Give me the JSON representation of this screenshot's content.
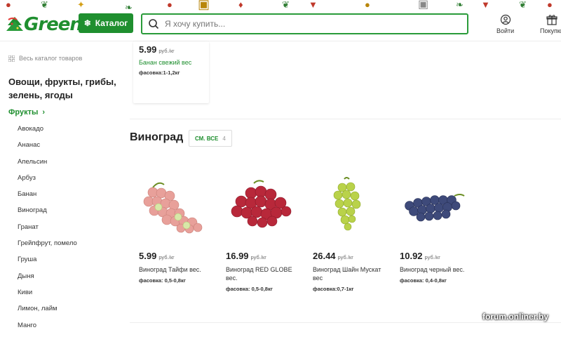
{
  "header": {
    "logo_text": "Green",
    "catalog_button": "Каталог",
    "search_placeholder": "Я хочу купить...",
    "login_label": "Войти",
    "cart_label": "Покупки",
    "brand_color": "#1f8f2f"
  },
  "sidebar": {
    "all_catalog": "Весь каталог товаров",
    "category_title": "Овощи, фрукты, грибы, зелень, ягоды",
    "active_category": "Фрукты",
    "items": [
      "Авокадо",
      "Ананас",
      "Апельсин",
      "Арбуз",
      "Банан",
      "Виноград",
      "Гранат",
      "Грейпфрут, помело",
      "Груша",
      "Дыня",
      "Киви",
      "Лимон, лайм",
      "Манго"
    ]
  },
  "top_card": {
    "price": "5.99",
    "unit": "руб./кг",
    "name": "Банан свежий вес",
    "pack": "фасовка:1-1,2кг"
  },
  "section": {
    "title": "Виноград",
    "see_all_label": "СМ. ВСЕ",
    "see_all_count": "4"
  },
  "products": [
    {
      "price": "5.99",
      "unit": "руб./кг",
      "name": "Виноград Тайфи вес.",
      "pack": "фасовка: 0,5-0,8кг",
      "image": "grape-pink-icon"
    },
    {
      "price": "16.99",
      "unit": "руб./кг",
      "name": "Виноград RED GLOBE вес.",
      "pack": "фасовка: 0,5-0,8кг",
      "image": "grape-red-icon"
    },
    {
      "price": "26.44",
      "unit": "руб./кг",
      "name": "Виноград Шайн Мускат вес",
      "pack": "фасовка:0,7-1кг",
      "image": "grape-green-icon"
    },
    {
      "price": "10.92",
      "unit": "руб./кг",
      "name": "Виноград черный вес.",
      "pack": "фасовка: 0,4-0,8кг",
      "image": "grape-black-icon"
    }
  ],
  "watermark": "forum.onliner.by"
}
